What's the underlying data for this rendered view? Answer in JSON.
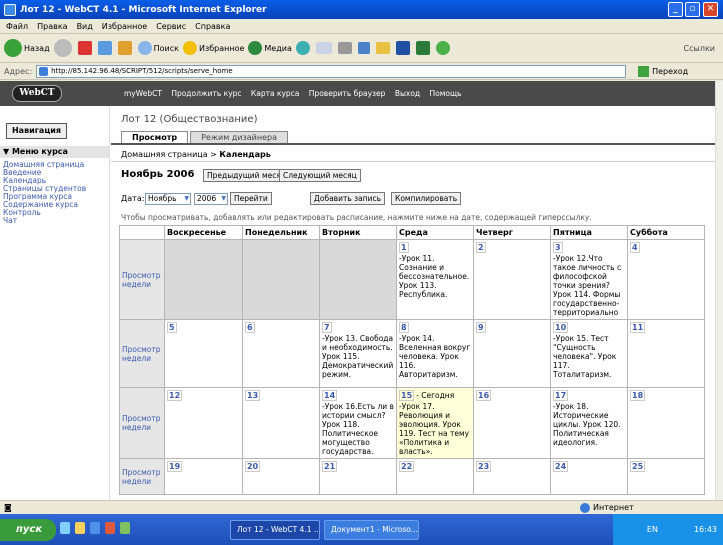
{
  "window": {
    "title": "Лот 12 - WebCT 4.1 - Microsoft Internet Explorer"
  },
  "menubar": [
    "Файл",
    "Правка",
    "Вид",
    "Избранное",
    "Сервис",
    "Справка"
  ],
  "toolbar": {
    "back": "Назад",
    "search": "Поиск",
    "favorites": "Избранное",
    "media": "Медиа",
    "links": "Ссылки"
  },
  "address": {
    "label": "Адрес:",
    "url": "http://85.142.96.48/SCRIPT/512/scripts/serve_home",
    "go": "Переход"
  },
  "webct": {
    "logo": "WebCT",
    "nav_links": [
      "myWebCT",
      "Продолжить курс",
      "Карта курса",
      "Проверить браузер",
      "Выход",
      "Помощь"
    ],
    "nav_button": "Навигация",
    "course_menu": "Меню курса",
    "menu_items": [
      "Домашняя страница",
      "Введение",
      "Календарь",
      "Страницы студентов",
      "Программа курса",
      "Содержание курса",
      "Контроль",
      "Чат"
    ],
    "course_title": "Лот 12 (Обществознание)",
    "tabs": [
      "Просмотр",
      "Режим дизайнера"
    ],
    "breadcrumb_home": "Домашняя страница >",
    "breadcrumb_current": "Календарь"
  },
  "calendar": {
    "month": "Ноябрь 2006",
    "prev_month": "Предыдущий месяц",
    "next_month": "Следующий месяц",
    "date_label": "Дата:",
    "month_select": "Ноябрь",
    "year_select": "2006",
    "go_button": "Перейти",
    "add_button": "Добавить запись",
    "compile_button": "Компилировать",
    "hint": "Чтобы просматривать, добавлять или редактировать расписание, нажмите ниже на дате, содержащей гиперссылку.",
    "weekdays": [
      "Воскресенье",
      "Понедельник",
      "Вторник",
      "Среда",
      "Четверг",
      "Пятница",
      "Суббота"
    ],
    "week_view": "Просмотр недели",
    "today_label": "- Сегодня",
    "weeks": [
      [
        null,
        null,
        null,
        {
          "day": "1",
          "events": [
            "-Урок 11. Сознание и бессознательное. Урок 113. Республика."
          ]
        },
        {
          "day": "2",
          "events": []
        },
        {
          "day": "3",
          "events": [
            "-Урок 12.Что такое личность с философской точки зрения? Урок 114. Формы государственно-территориально"
          ]
        },
        {
          "day": "4",
          "events": []
        }
      ],
      [
        {
          "day": "5",
          "events": []
        },
        {
          "day": "6",
          "events": []
        },
        {
          "day": "7",
          "events": [
            "-Урок 13. Свобода и необходимость. Урок 115. Демократический режим."
          ]
        },
        {
          "day": "8",
          "events": [
            "-Урок 14. Вселенная вокруг человека. Урок 116. Авторитаризм."
          ]
        },
        {
          "day": "9",
          "events": []
        },
        {
          "day": "10",
          "events": [
            "-Урок 15. Тест \"Сущность человека\". Урок 117. Тоталитаризм."
          ]
        },
        {
          "day": "11",
          "events": []
        }
      ],
      [
        {
          "day": "12",
          "events": []
        },
        {
          "day": "13",
          "events": []
        },
        {
          "day": "14",
          "events": [
            "-Урок 16.Есть ли в истории смысл? Урок 118. Политическое могущество государства."
          ]
        },
        {
          "day": "15",
          "today": true,
          "events": [
            "-Урок 17. Революция и эволюция. Урок 119. Тест на тему «Политика и власть»."
          ]
        },
        {
          "day": "16",
          "events": []
        },
        {
          "day": "17",
          "events": [
            "-Урок 18. Исторические циклы. Урок 120. Политическая идеология."
          ]
        },
        {
          "day": "18",
          "events": []
        }
      ],
      [
        {
          "day": "19",
          "events": []
        },
        {
          "day": "20",
          "events": []
        },
        {
          "day": "21",
          "events": []
        },
        {
          "day": "22",
          "events": []
        },
        {
          "day": "23",
          "events": []
        },
        {
          "day": "24",
          "events": []
        },
        {
          "day": "25",
          "events": []
        }
      ]
    ]
  },
  "status": {
    "zone": "Интернет"
  },
  "taskbar": {
    "start": "пуск",
    "tasks": [
      "Лот 12 - WebCT 4.1 ...",
      "Документ1 - Microso..."
    ],
    "lang": "EN",
    "clock": "16:43"
  }
}
